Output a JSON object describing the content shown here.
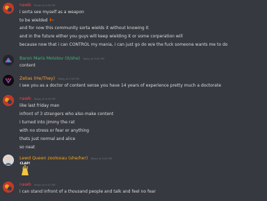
{
  "messages": [
    {
      "username": "nawb",
      "username_color": "#f04747",
      "timestamp": "Today at 4:59 PM",
      "lines": [
        "i sorta see myself as a weapon",
        "to be wielded",
        "and for now this community sorta wields it without knowing it",
        "and in the future either you guys will keep wielding it or some corperation will",
        "because now that i can CONTROL my mania, i can just go do w/e the fuck someone wants me to do"
      ]
    },
    {
      "username": "Baron Maris Molotov (it/she)",
      "username_color": "#43b581",
      "timestamp": "Today at 5:00 PM",
      "lines": [
        "content"
      ]
    },
    {
      "username": "Zelias (He/They)",
      "username_color": "#f4a142",
      "timestamp": "Today at 5:00 PM",
      "lines": [
        "I see you as a doctor of content sense you have 14 years of experience pretty much a doctorate"
      ]
    },
    {
      "username": "nawb",
      "username_color": "#f04747",
      "timestamp": "Today at 5:00 PM",
      "lines": [
        "like last friday man",
        "infront of 3 strangers who also make content",
        "i turned into jimmy the rat",
        "with no stress or fear or anything",
        "thats just normal and alice",
        "so neat"
      ]
    },
    {
      "username": "Lewd Queen zoolooau (she/her)",
      "username_color": "#faa61a",
      "timestamp": "Today at 5:00 PM",
      "lines": [],
      "image_text": "CLAP!"
    },
    {
      "username": "nawb",
      "username_color": "#f04747",
      "timestamp": "Today at 5:01 PM",
      "lines": [
        "i can stand infront of a thousand people and talk and feel no fear"
      ]
    }
  ]
}
